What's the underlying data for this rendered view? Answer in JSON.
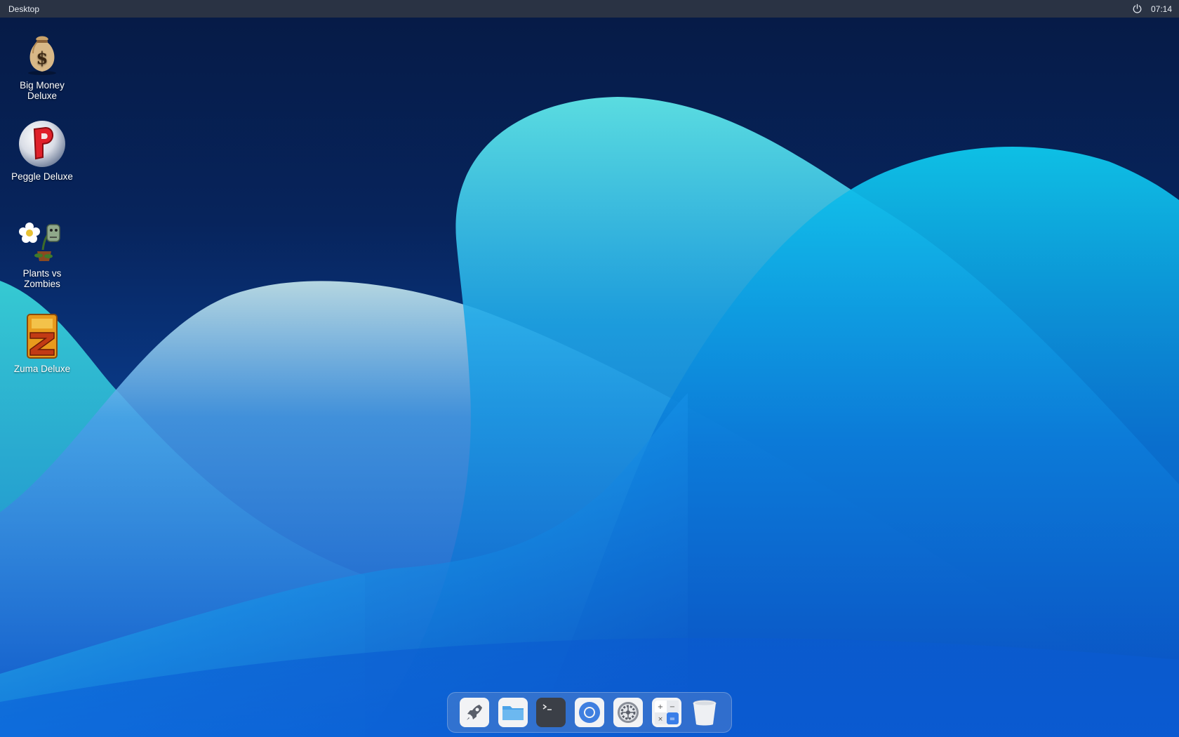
{
  "topbar": {
    "title": "Desktop",
    "clock": "07:14",
    "power_icon": "power-icon"
  },
  "desktop_icons": [
    {
      "label": "Big Money\nDeluxe",
      "icon": "money-bag-icon"
    },
    {
      "label": "Peggle Deluxe",
      "icon": "peggle-icon"
    },
    {
      "label": "Plants vs\nZombies",
      "icon": "plants-vs-zombies-icon"
    },
    {
      "label": "Zuma Deluxe",
      "icon": "zuma-icon"
    }
  ],
  "dock": {
    "items": [
      {
        "icon": "launcher-rocket-icon"
      },
      {
        "icon": "files-folder-icon"
      },
      {
        "icon": "terminal-icon"
      },
      {
        "icon": "browser-icon"
      },
      {
        "icon": "settings-gear-icon"
      },
      {
        "icon": "calculator-icon"
      },
      {
        "icon": "trash-icon"
      }
    ]
  },
  "colors": {
    "topbar_bg": "#2a3344",
    "wallpaper_dark": "#061a45",
    "wallpaper_cyan": "#2fd0e0",
    "wallpaper_blue": "#0c56c4"
  }
}
